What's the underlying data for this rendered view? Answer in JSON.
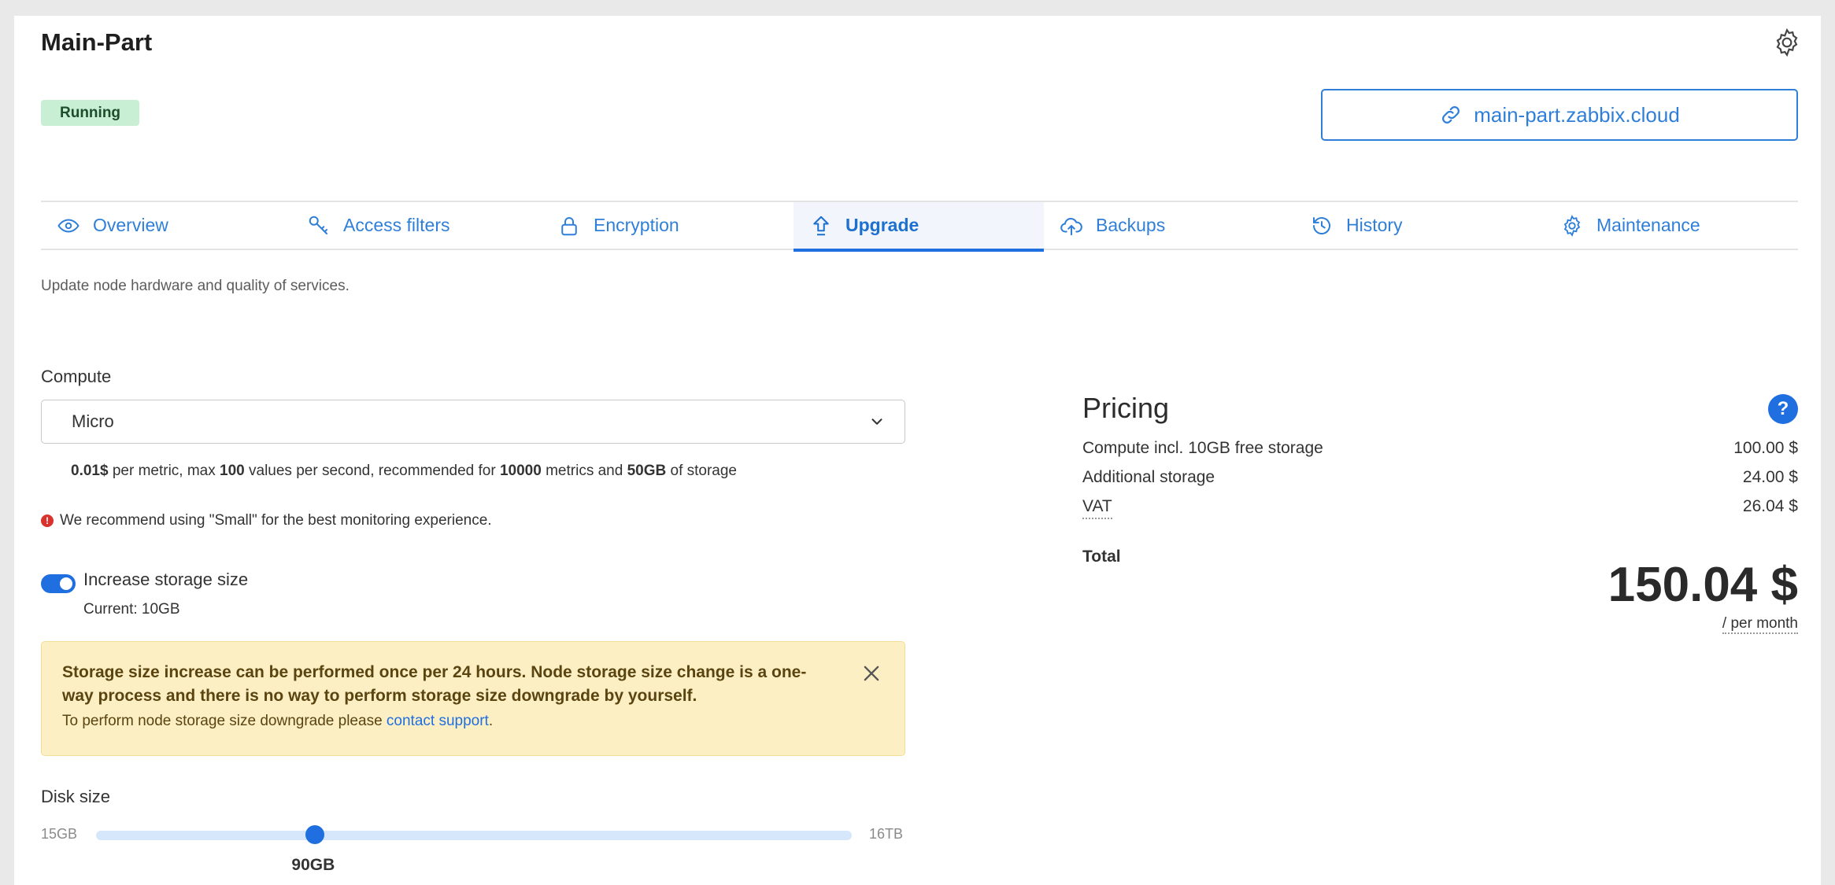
{
  "header": {
    "title": "Main-Part",
    "status": "Running",
    "url": "main-part.zabbix.cloud"
  },
  "tabs": [
    {
      "label": "Overview",
      "icon": "eye-icon"
    },
    {
      "label": "Access filters",
      "icon": "key-icon"
    },
    {
      "label": "Encryption",
      "icon": "lock-icon"
    },
    {
      "label": "Upgrade",
      "icon": "upload-arrow-icon",
      "active": true
    },
    {
      "label": "Backups",
      "icon": "cloud-upload-icon"
    },
    {
      "label": "History",
      "icon": "history-icon"
    },
    {
      "label": "Maintenance",
      "icon": "gear-wrench-icon"
    }
  ],
  "subtitle": "Update node hardware and quality of services.",
  "compute": {
    "label": "Compute",
    "selected": "Micro",
    "desc": {
      "price": "0.01$",
      "t1": " per metric, max ",
      "max_values": "100",
      "t2": " values per second, recommended for ",
      "metrics": "10000",
      "t3": " metrics and ",
      "storage": "50GB",
      "t4": " of storage"
    },
    "warning": "We recommend using \"Small\" for the best monitoring experience."
  },
  "storage": {
    "toggle_label": "Increase storage size",
    "toggle_on": true,
    "current": "Current: 10GB"
  },
  "alert": {
    "bold": "Storage size increase can be performed once per 24 hours. Node storage size change is a one-way process and there is no way to perform storage size downgrade by yourself.",
    "text": "To perform node storage size downgrade please ",
    "link": "contact support",
    "text_end": "."
  },
  "disk": {
    "label": "Disk size",
    "min": "15GB",
    "max": "16TB",
    "value": "90GB",
    "fraction": 0.29
  },
  "pricing": {
    "title": "Pricing",
    "rows": [
      {
        "label": "Compute incl. 10GB free storage",
        "amount": "100.00 $"
      },
      {
        "label": "Additional storage",
        "amount": "24.00 $"
      },
      {
        "label": "VAT",
        "amount": "26.04 $"
      }
    ],
    "total_label": "Total",
    "total": "150.04 $",
    "period": "/ per month"
  },
  "colors": {
    "accent": "#1f6fe0",
    "status_bg": "#c8efd4",
    "alert_bg": "#fcefc4"
  }
}
